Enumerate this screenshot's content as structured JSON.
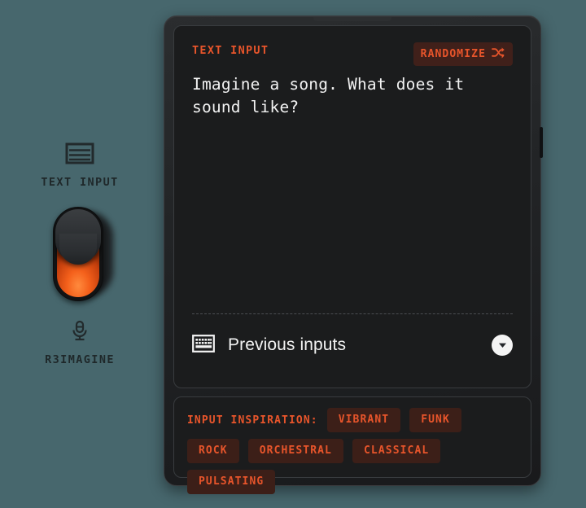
{
  "app": {
    "name": "R3IMAGINE",
    "background_color": "#47676d",
    "accent_color": "#e8552b"
  },
  "sidebar": {
    "top_mode": {
      "icon": "text-lines-icon",
      "label": "TEXT INPUT"
    },
    "toggle": {
      "name": "input-mode-toggle",
      "position": "up",
      "lit_color": "#f4601b"
    },
    "bottom_mode": {
      "icon": "microphone-icon",
      "label": "R3IMAGINE"
    }
  },
  "panel": {
    "title": "TEXT INPUT",
    "randomize": {
      "label": "RANDOMIZE",
      "icon": "shuffle-icon"
    },
    "text_input": {
      "value": "",
      "placeholder": "Imagine a song. What does it sound like?"
    },
    "previous_inputs": {
      "icon": "keyboard-icon",
      "label": "Previous inputs",
      "expand_icon": "chevron-down-icon"
    }
  },
  "inspiration": {
    "label": "INPUT INSPIRATION:",
    "chips": [
      "VIBRANT",
      "FUNK",
      "ROCK",
      "ORCHESTRAL",
      "CLASSICAL",
      "PULSATING"
    ]
  }
}
